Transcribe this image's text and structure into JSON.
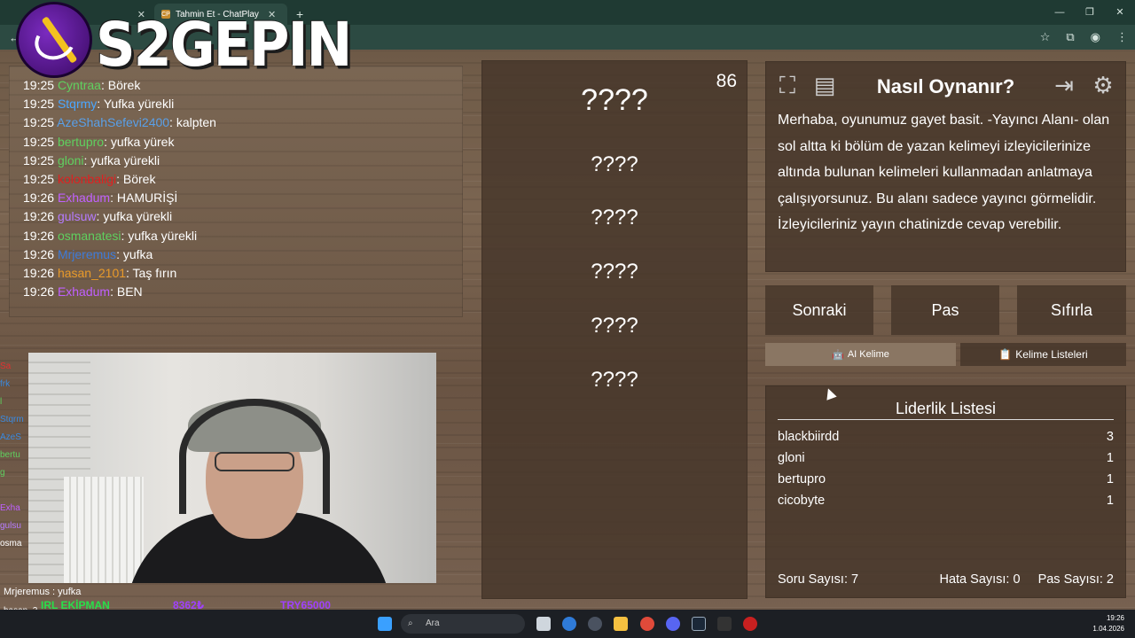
{
  "browser": {
    "tabs": [
      {
        "label": "",
        "favicon": "",
        "active": false
      },
      {
        "label": "Tahmin Et - ChatPlay",
        "favicon": "CP",
        "active": true
      }
    ],
    "new_tab": "+",
    "window_controls": [
      "—",
      "❐",
      "✕"
    ]
  },
  "overlay": {
    "logo_text": "S2GEPIN"
  },
  "chat": {
    "messages": [
      {
        "time": "19:25",
        "user": "Cyntraa",
        "text": "Börek",
        "color": "#5fd05f"
      },
      {
        "time": "19:25",
        "user": "Stqrmy",
        "text": "Yufka yürekli",
        "color": "#4aa6ff"
      },
      {
        "time": "19:25",
        "user": "AzeShahSefevi2400",
        "text": "kalpten",
        "color": "#5aa0e8"
      },
      {
        "time": "19:25",
        "user": "bertupro",
        "text": "yufka yürek",
        "color": "#5fd05f"
      },
      {
        "time": "19:25",
        "user": "gloni",
        "text": "yufka yürekli",
        "color": "#5fd05f"
      },
      {
        "time": "19:25",
        "user": "kolonbaligi",
        "text": "Börek",
        "color": "#e02020"
      },
      {
        "time": "19:26",
        "user": "Exhadum",
        "text": "HAMURİŞİ",
        "color": "#c060ff"
      },
      {
        "time": "19:26",
        "user": "gulsuw",
        "text": "yufka yürekli",
        "color": "#b57bff"
      },
      {
        "time": "19:26",
        "user": "osmanatesi",
        "text": "yufka yürekli",
        "color": "#5fd05f"
      },
      {
        "time": "19:26",
        "user": "Mrjeremus",
        "text": "yufka",
        "color": "#3d7ad8"
      },
      {
        "time": "19:26",
        "user": "hasan_2101",
        "text": "Taş fırın",
        "color": "#e89a2a"
      },
      {
        "time": "19:26",
        "user": "Exhadum",
        "text": "BEN",
        "color": "#c060ff"
      }
    ]
  },
  "game": {
    "timer": "86",
    "hidden_words": [
      "????",
      "????",
      "????",
      "????",
      "????",
      "????"
    ]
  },
  "info": {
    "title": "Nasıl Oynanır?",
    "text": "Merhaba, oyunumuz gayet basit. -Yayıncı Alanı- olan sol altta ki bölüm de yazan kelimeyi izleyicilerinize altında bulunan kelimeleri kullanmadan anlatmaya çalışıyorsunuz. Bu alanı sadece yayıncı görmelidir. İzleyicileriniz yayın chatinizde cevap verebilir."
  },
  "controls": {
    "next": "Sonraki",
    "pass": "Pas",
    "reset": "Sıfırla",
    "ai_word": "AI Kelime",
    "word_lists": "Kelime Listeleri"
  },
  "leaderboard": {
    "title": "Liderlik Listesi",
    "entries": [
      {
        "name": "blackbiirdd",
        "score": "3"
      },
      {
        "name": "gloni",
        "score": "1"
      },
      {
        "name": "bertupro",
        "score": "1"
      },
      {
        "name": "cicobyte",
        "score": "1"
      }
    ],
    "stats": {
      "questions": "Soru Sayısı: 7",
      "errors": "Hata Sayısı: 0",
      "passes": "Pas Sayısı: 2"
    }
  },
  "stream_overlay": {
    "side_chat": [
      "Sa",
      "frk",
      "l",
      "Stqrm",
      "AzeS",
      "bertu",
      "g",
      "",
      "Exha",
      "gulsu",
      "osma"
    ],
    "bottom_line": "Mrjeremus : yufka",
    "bottom_user": "hasan_2",
    "bottom_user2": "Exhadum : BEN",
    "ticker": [
      "IRL EKİPMAN",
      "8362₺",
      "TRY65000"
    ]
  },
  "taskbar": {
    "search_placeholder": "Ara",
    "time": "19:26",
    "date": "1.04.2026"
  }
}
